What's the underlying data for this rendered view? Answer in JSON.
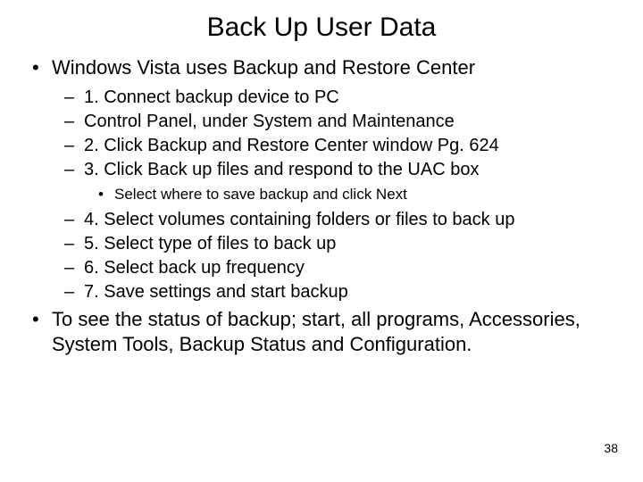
{
  "title": "Back Up User Data",
  "bullets": {
    "b1": "Windows Vista uses Backup and Restore Center",
    "d1": "1. Connect backup device to PC",
    "d2": "Control Panel, under System and Maintenance",
    "d3": "2. Click Backup and Restore Center window Pg. 624",
    "d4": "3. Click Back up files and respond to the UAC box",
    "s1": "Select where to save backup and click Next",
    "d5": "4. Select volumes containing folders or files to back up",
    "d6": "5. Select type of files to back up",
    "d7": "6. Select back up frequency",
    "d8": "7. Save settings and start backup",
    "b2": "To see the status of backup; start, all programs, Accessories, System Tools, Backup Status and Configuration."
  },
  "page_number": "38"
}
